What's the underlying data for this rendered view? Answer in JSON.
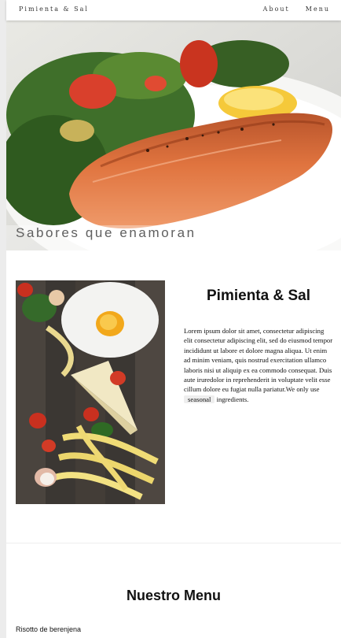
{
  "nav": {
    "brand": "Pimienta & Sal",
    "links": [
      {
        "label": "About"
      },
      {
        "label": "Menu"
      }
    ]
  },
  "hero": {
    "caption": "Sabores que enamoran",
    "image": "grilled salmon with salad on a white plate"
  },
  "about": {
    "title": "Pimienta & Sal",
    "body_before_tag": "Lorem ipsum dolor sit amet, consectetur adipiscing elit consectetur adipiscing elit, sed do eiusmod tempor incididunt ut labore et dolore magna aliqua. Ut enim ad minim veniam, quis nostrud exercitation ullamco laboris nisi ut aliquip ex ea commodo consequat. Duis aute iruredolor in reprehenderit in voluptate velit esse cillum dolore eu fugiat nulla pariatur.We only use",
    "tag": "seasonal",
    "body_after_tag": "ingredients.",
    "image": "fresh pasta with flour, egg, tomatoes, basil and cheese on wooden table"
  },
  "menu": {
    "title": "Nuestro Menu",
    "items": [
      {
        "name": "Risotto de berenjena"
      }
    ]
  }
}
